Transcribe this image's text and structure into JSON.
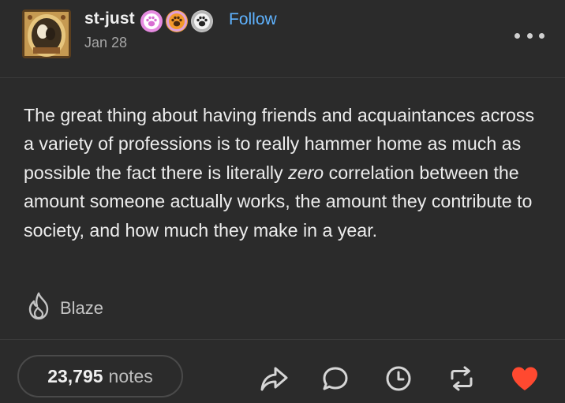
{
  "post": {
    "username": "st-just",
    "follow_label": "Follow",
    "date": "Jan 28",
    "avatar_icon": "portrait-avatar",
    "badges": [
      {
        "name": "paw-badge-pink",
        "color": "#e58be0"
      },
      {
        "name": "paw-badge-orange",
        "color": "#f0a030"
      },
      {
        "name": "paw-badge-gray",
        "color": "#c8c8c8"
      }
    ],
    "body": {
      "before_emphasis": "The great thing about having friends and acquaintances across a variety of professions is to really hammer home as much as possible the fact there is literally ",
      "emphasis": "zero",
      "after_emphasis": " correlation between the amount someone actually works, the amount they contribute to society, and how much they make in a year."
    },
    "blaze_label": "Blaze",
    "notes_count": "23,795",
    "notes_label": "notes",
    "actions": [
      "share-icon",
      "reply-icon",
      "schedule-icon",
      "reblog-icon",
      "like-icon"
    ],
    "colors": {
      "background": "#2b2b2b",
      "follow": "#5fb3ff",
      "like": "#ff4930",
      "text": "#ededed",
      "muted": "#a6a6a6"
    }
  }
}
